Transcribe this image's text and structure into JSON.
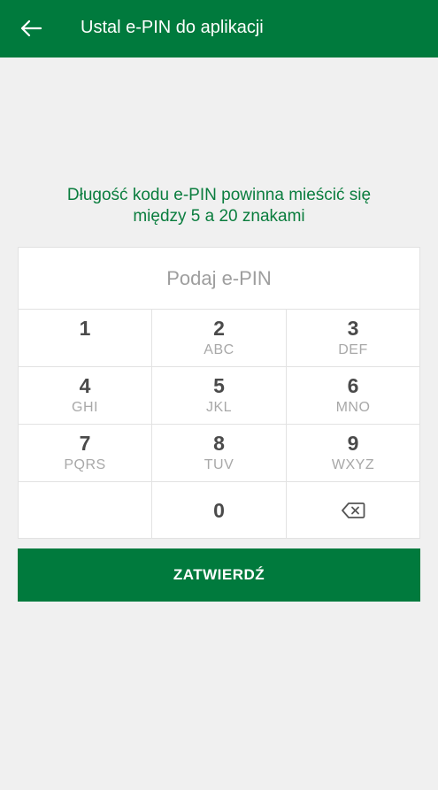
{
  "appbar": {
    "title": "Ustal e-PIN do aplikacji",
    "back_icon": "arrow-left-icon"
  },
  "colors": {
    "brand_green": "#007a3d",
    "hint_green": "#0a7d3e",
    "background": "#f0f0f0"
  },
  "hint": {
    "line1": "Długość kodu e-PIN powinna mieścić się",
    "line2": "między 5 a 20 znakami"
  },
  "pin": {
    "placeholder": "Podaj e-PIN",
    "value": ""
  },
  "keypad": {
    "keys": [
      {
        "digit": "1",
        "letters": ""
      },
      {
        "digit": "2",
        "letters": "ABC"
      },
      {
        "digit": "3",
        "letters": "DEF"
      },
      {
        "digit": "4",
        "letters": "GHI"
      },
      {
        "digit": "5",
        "letters": "JKL"
      },
      {
        "digit": "6",
        "letters": "MNO"
      },
      {
        "digit": "7",
        "letters": "PQRS"
      },
      {
        "digit": "8",
        "letters": "TUV"
      },
      {
        "digit": "9",
        "letters": "WXYZ"
      },
      {
        "digit": "0",
        "letters": ""
      }
    ],
    "backspace_icon": "backspace-icon"
  },
  "submit": {
    "label": "ZATWIERDŹ"
  }
}
